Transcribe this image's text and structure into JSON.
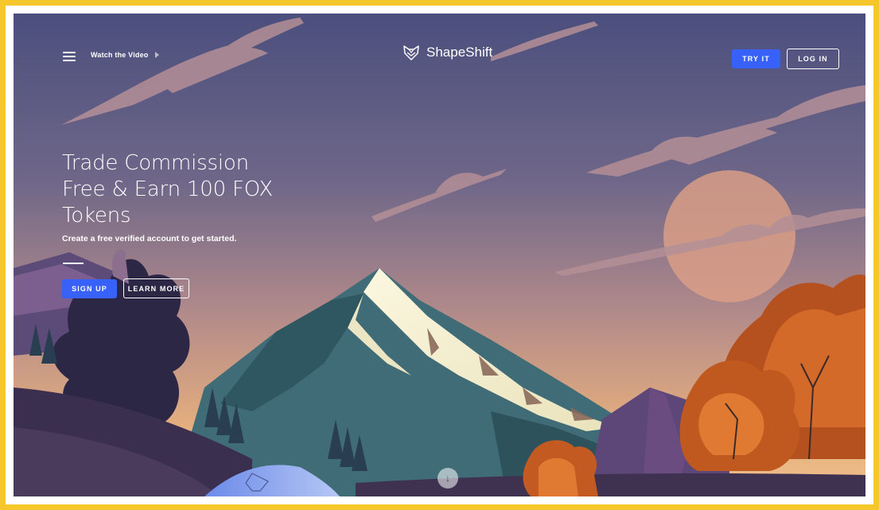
{
  "nav": {
    "menu_icon": "hamburger-menu-icon",
    "watch_video": "Watch the Video",
    "play_icon": "play-triangle-icon",
    "brand": "ShapeShift",
    "brand_icon": "fox-head-logo-icon",
    "try_it": "TRY IT",
    "log_in": "LOG IN"
  },
  "hero": {
    "title_lines": [
      "Trade Commission",
      "Free & Earn 100 FOX",
      "Tokens"
    ],
    "subtitle": "Create a free verified account to get started.",
    "sign_up": "SIGN UP",
    "learn_more": "LEARN MORE"
  },
  "scroll": {
    "icon": "arrow-down-icon",
    "glyph": "↓"
  },
  "colors": {
    "frame_border": "#f5c72a",
    "primary_button": "#3761f9",
    "sky_top": "#4a4f7c",
    "sky_bottom": "#d9a27a"
  }
}
